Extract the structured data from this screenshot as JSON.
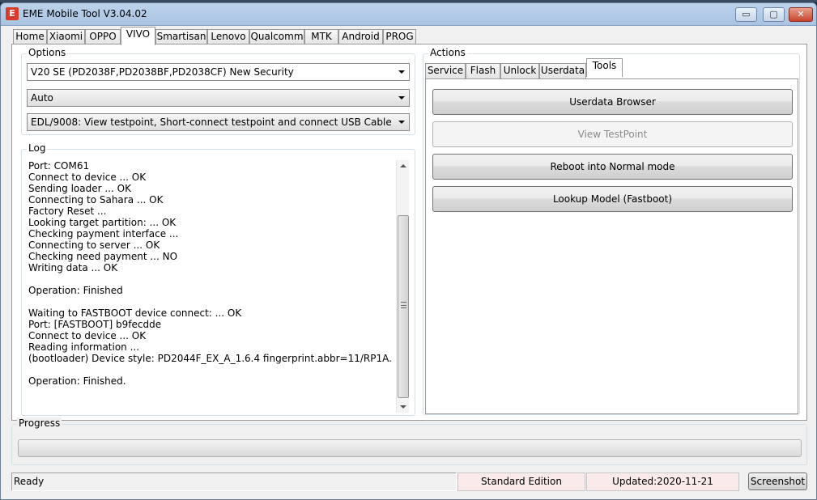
{
  "window": {
    "title": "EME Mobile Tool V3.04.02",
    "icon_letter": "E",
    "controls": {
      "minimize": "▭",
      "maximize": "▢",
      "close": "✕"
    }
  },
  "main_tabs": [
    "Home",
    "Xiaomi",
    "OPPO",
    "VIVO",
    "Smartisan",
    "Lenovo",
    "Qualcomm",
    "MTK",
    "Android",
    "PROG"
  ],
  "main_tab_active": "VIVO",
  "options": {
    "label": "Options",
    "model_select": "V20 SE (PD2038F,PD2038BF,PD2038CF) New Security",
    "mode_select": "Auto",
    "connection_select": "EDL/9008: View testpoint, Short-connect testpoint and connect USB Cable"
  },
  "log": {
    "label": "Log",
    "lines": [
      "Port: COM61",
      "Connect to device ... OK",
      "Sending loader ... OK",
      "Connecting to Sahara ... OK",
      "Factory Reset ...",
      "Looking target partition: ... OK",
      "Checking payment interface ...",
      "Connecting to server ... OK",
      "Checking need payment ... NO",
      "Writing data ... OK",
      "",
      "Operation: Finished",
      "",
      "Waiting to FASTBOOT device connect: ... OK",
      "Port: [FASTBOOT] b9fecdde",
      "Connect to device ... OK",
      "Reading information ...",
      "(bootloader) Device style: PD2044F_EX_A_1.6.4 fingerprint.abbr=11/RP1A.",
      "",
      "Operation: Finished."
    ]
  },
  "actions": {
    "label": "Actions",
    "tabs": [
      "Service",
      "Flash",
      "Unlock",
      "Userdata",
      "Tools"
    ],
    "active_tab": "Tools",
    "buttons": {
      "userdata_browser": "Userdata Browser",
      "view_testpoint": "View TestPoint",
      "reboot_normal": "Reboot into Normal mode",
      "lookup_model": "Lookup Model (Fastboot)"
    }
  },
  "progress": {
    "label": "Progress",
    "value_percent": 0
  },
  "status": {
    "ready": "Ready",
    "edition": "Standard Edition",
    "updated": "Updated:2020-11-21",
    "screenshot_button": "Screenshot"
  },
  "colors": {
    "titlebar": "#a9c3e1",
    "close_button": "#c8432b",
    "status_highlight": "#fbeaea",
    "app_icon": "#d93b2b"
  }
}
